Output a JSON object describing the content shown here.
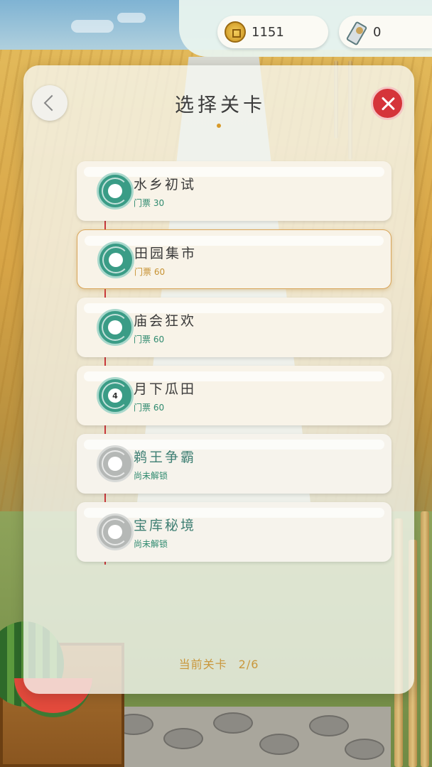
{
  "currency": {
    "coins": "1151",
    "scrolls": "0",
    "coin_icon": "coin-icon",
    "scroll_icon": "scroll-icon"
  },
  "panel": {
    "title": "选择关卡",
    "back_icon": "chevron-left-icon",
    "close_icon": "close-icon",
    "footer_label": "当前关卡",
    "footer_value": "2/6"
  },
  "levels": [
    {
      "name": "水乡初试",
      "sub": "门票 30",
      "state": "unlocked",
      "badge": ""
    },
    {
      "name": "田园集市",
      "sub": "门票 60",
      "state": "selected",
      "badge": ""
    },
    {
      "name": "庙会狂欢",
      "sub": "门票 60",
      "state": "unlocked",
      "badge": ""
    },
    {
      "name": "月下瓜田",
      "sub": "门票 60",
      "state": "unlocked",
      "badge": "4"
    },
    {
      "name": "鹈王争霸",
      "sub": "尚未解锁",
      "state": "locked",
      "badge": ""
    },
    {
      "name": "宝库秘境",
      "sub": "尚未解锁",
      "state": "locked",
      "badge": ""
    }
  ],
  "colors": {
    "accent_green": "#3a9c86",
    "accent_gold": "#c9973c",
    "close_red": "#d5343a",
    "timeline_red": "#c9383c"
  }
}
